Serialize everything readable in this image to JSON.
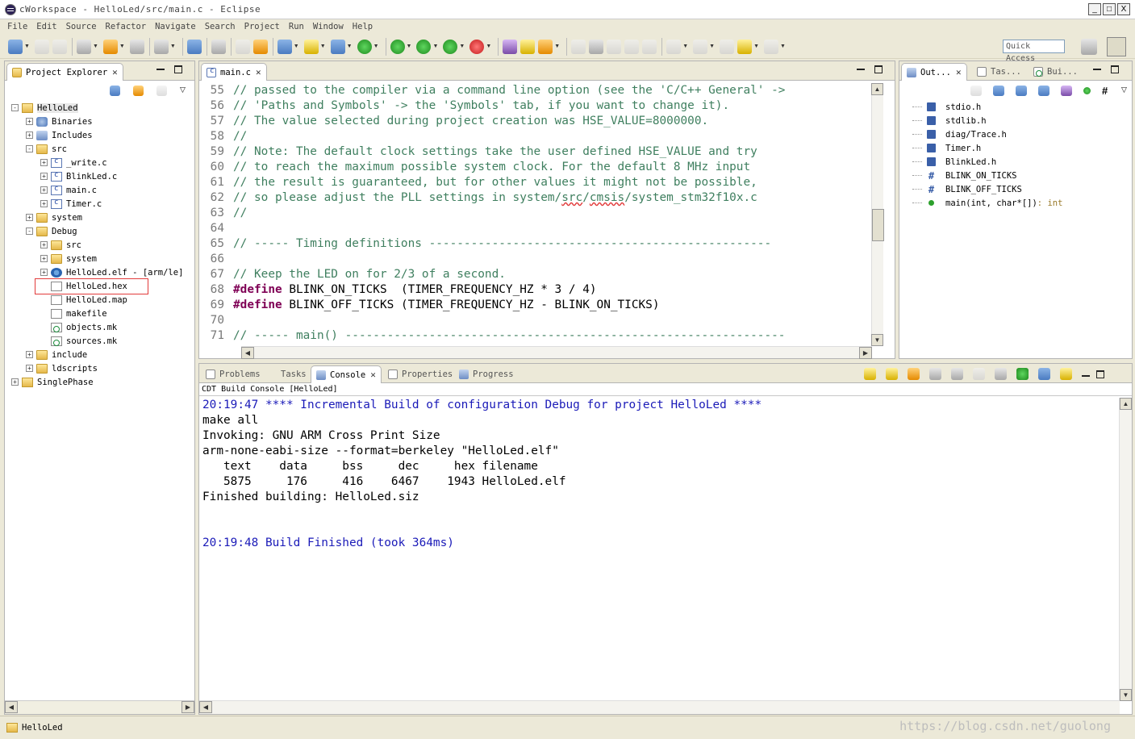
{
  "window": {
    "title": "cWorkspace - HelloLed/src/main.c - Eclipse",
    "buttons": {
      "minimize": "_",
      "restore": "□",
      "close": "X"
    }
  },
  "menubar": [
    "File",
    "Edit",
    "Source",
    "Refactor",
    "Navigate",
    "Search",
    "Project",
    "Run",
    "Window",
    "Help"
  ],
  "toolbar": {
    "quick_access": "Quick Access"
  },
  "explorer": {
    "tab_label": "Project Explorer",
    "tree": [
      {
        "label": "HelloLed",
        "depth": 0,
        "expander": "-",
        "icon": "project-icon",
        "selected": true
      },
      {
        "label": "Binaries",
        "depth": 1,
        "expander": "+",
        "icon": "binaries-icon"
      },
      {
        "label": "Includes",
        "depth": 1,
        "expander": "+",
        "icon": "includes-icon"
      },
      {
        "label": "src",
        "depth": 1,
        "expander": "-",
        "icon": "folder-icon"
      },
      {
        "label": "_write.c",
        "depth": 2,
        "expander": "+",
        "icon": "c-file-icon"
      },
      {
        "label": "BlinkLed.c",
        "depth": 2,
        "expander": "+",
        "icon": "c-file-icon"
      },
      {
        "label": "main.c",
        "depth": 2,
        "expander": "+",
        "icon": "c-file-icon"
      },
      {
        "label": "Timer.c",
        "depth": 2,
        "expander": "+",
        "icon": "c-file-icon"
      },
      {
        "label": "system",
        "depth": 1,
        "expander": "+",
        "icon": "folder-icon"
      },
      {
        "label": "Debug",
        "depth": 1,
        "expander": "-",
        "icon": "folder-icon"
      },
      {
        "label": "src",
        "depth": 2,
        "expander": "+",
        "icon": "folder-icon"
      },
      {
        "label": "system",
        "depth": 2,
        "expander": "+",
        "icon": "folder-icon"
      },
      {
        "label": "HelloLed.elf - [arm/le]",
        "depth": 2,
        "expander": "+",
        "icon": "elf-binary-icon"
      },
      {
        "label": "HelloLed.hex",
        "depth": 2,
        "expander": "",
        "icon": "text-file-icon"
      },
      {
        "label": "HelloLed.map",
        "depth": 2,
        "expander": "",
        "icon": "text-file-icon"
      },
      {
        "label": "makefile",
        "depth": 2,
        "expander": "",
        "icon": "text-file-icon"
      },
      {
        "label": "objects.mk",
        "depth": 2,
        "expander": "",
        "icon": "makefile-icon"
      },
      {
        "label": "sources.mk",
        "depth": 2,
        "expander": "",
        "icon": "makefile-icon"
      },
      {
        "label": "include",
        "depth": 1,
        "expander": "+",
        "icon": "folder-icon"
      },
      {
        "label": "ldscripts",
        "depth": 1,
        "expander": "+",
        "icon": "folder-icon"
      },
      {
        "label": "SinglePhase",
        "depth": 0,
        "expander": "+",
        "icon": "project-icon"
      }
    ]
  },
  "editor": {
    "tab_label": "main.c",
    "lines": [
      {
        "n": "55",
        "segments": [
          {
            "t": "// passed to the compiler via a command line option (see the 'C/C++ General' ->",
            "c": "cm"
          }
        ]
      },
      {
        "n": "56",
        "segments": [
          {
            "t": "// 'Paths and Symbols' -> the 'Symbols' tab, if you want to change it).",
            "c": "cm"
          }
        ]
      },
      {
        "n": "57",
        "segments": [
          {
            "t": "// The value selected during project creation was HSE_VALUE=8000000.",
            "c": "cm"
          }
        ]
      },
      {
        "n": "58",
        "segments": [
          {
            "t": "//",
            "c": "cm"
          }
        ]
      },
      {
        "n": "59",
        "segments": [
          {
            "t": "// Note: The default clock settings take the user defined HSE_VALUE and try",
            "c": "cm"
          }
        ]
      },
      {
        "n": "60",
        "segments": [
          {
            "t": "// to reach the maximum possible system clock. For the default 8 MHz input",
            "c": "cm"
          }
        ]
      },
      {
        "n": "61",
        "segments": [
          {
            "t": "// the result is guaranteed, but for other values it might not be possible,",
            "c": "cm"
          }
        ]
      },
      {
        "n": "62",
        "segments": [
          {
            "t": "// so please adjust the PLL settings in system/",
            "c": "cm"
          },
          {
            "t": "src",
            "c": "cm uline"
          },
          {
            "t": "/",
            "c": "cm"
          },
          {
            "t": "cmsis",
            "c": "cm uline"
          },
          {
            "t": "/system_stm32f10x.c",
            "c": "cm"
          }
        ]
      },
      {
        "n": "63",
        "segments": [
          {
            "t": "//",
            "c": "cm"
          }
        ]
      },
      {
        "n": "64",
        "segments": [
          {
            "t": "",
            "c": "mc"
          }
        ]
      },
      {
        "n": "65",
        "segments": [
          {
            "t": "// ----- Timing definitions -------------------------------------------------",
            "c": "cm"
          }
        ]
      },
      {
        "n": "66",
        "segments": [
          {
            "t": "",
            "c": "mc"
          }
        ]
      },
      {
        "n": "67",
        "segments": [
          {
            "t": "// Keep the LED on for 2/3 of a second.",
            "c": "cm"
          }
        ]
      },
      {
        "n": "68",
        "segments": [
          {
            "t": "#define",
            "c": "kw"
          },
          {
            "t": " BLINK_ON_TICKS  (TIMER_FREQUENCY_HZ * 3 / 4)",
            "c": "mc"
          }
        ]
      },
      {
        "n": "69",
        "segments": [
          {
            "t": "#define",
            "c": "kw"
          },
          {
            "t": " BLINK_OFF_TICKS (TIMER_FREQUENCY_HZ - BLINK_ON_TICKS)",
            "c": "mc"
          }
        ]
      },
      {
        "n": "70",
        "segments": [
          {
            "t": "",
            "c": "mc"
          }
        ]
      },
      {
        "n": "71",
        "segments": [
          {
            "t": "// ----- main() ---------------------------------------------------------------",
            "c": "cm"
          }
        ]
      }
    ]
  },
  "outline": {
    "tabs": [
      "Out...",
      "Tas...",
      "Bui..."
    ],
    "items": [
      {
        "label": "stdio.h",
        "kind": "include"
      },
      {
        "label": "stdlib.h",
        "kind": "include"
      },
      {
        "label": "diag/Trace.h",
        "kind": "include"
      },
      {
        "label": "Timer.h",
        "kind": "include"
      },
      {
        "label": "BlinkLed.h",
        "kind": "include"
      },
      {
        "label": "BLINK_ON_TICKS",
        "kind": "macro"
      },
      {
        "label": "BLINK_OFF_TICKS",
        "kind": "macro"
      },
      {
        "label": "main(int, char*[])",
        "kind": "function",
        "ret": " : int"
      }
    ]
  },
  "console": {
    "tabs": [
      "Problems",
      "Tasks",
      "Console",
      "Properties",
      "Progress"
    ],
    "active_tab": "Console",
    "subtitle": "CDT Build Console [HelloLed]",
    "lines": [
      {
        "t": "20:19:47 **** Incremental Build of configuration Debug for project HelloLed ****",
        "c": "blue"
      },
      {
        "t": "make all",
        "c": ""
      },
      {
        "t": "Invoking: GNU ARM Cross Print Size",
        "c": ""
      },
      {
        "t": "arm-none-eabi-size --format=berkeley \"HelloLed.elf\"",
        "c": ""
      },
      {
        "t": "   text    data     bss     dec     hex filename",
        "c": ""
      },
      {
        "t": "   5875     176     416    6467    1943 HelloLed.elf",
        "c": ""
      },
      {
        "t": "Finished building: HelloLed.siz",
        "c": ""
      },
      {
        "t": " ",
        "c": ""
      },
      {
        "t": " ",
        "c": ""
      },
      {
        "t": "20:19:48 Build Finished (took 364ms)",
        "c": "blue"
      }
    ]
  },
  "status": {
    "text": "HelloLed",
    "watermark": "https://blog.csdn.net/guolong"
  }
}
